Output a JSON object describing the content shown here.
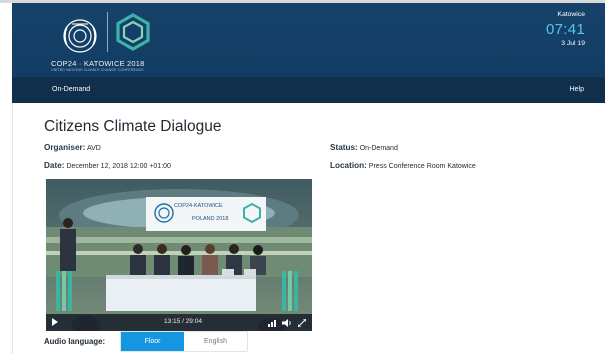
{
  "brand": {
    "event_title": "COP24 · KATOWICE 2018",
    "subtitle": "UNITED NATIONS CLIMATE CHANGE CONFERENCE"
  },
  "clock": {
    "location": "Katowice",
    "time": "07:41",
    "date": "3 Jul 19"
  },
  "nav": {
    "left": "On-Demand",
    "right": "Help"
  },
  "session": {
    "title": "Citizens Climate Dialogue",
    "organiser_label": "Organiser:",
    "organiser_value": "AVD",
    "status_label": "Status:",
    "status_value": "On-Demand",
    "date_label": "Date:",
    "date_value": "December 12, 2018 12:00 +01:00",
    "location_label": "Location:",
    "location_value": "Press Conference Room Katowice"
  },
  "video": {
    "backdrop_line1": "COP24·KATOWICE",
    "backdrop_line2": "POLAND 2018",
    "timecode": "13:15 / 29:04",
    "icons": [
      "play-icon",
      "quality-icon",
      "volume-icon",
      "fullscreen-icon"
    ]
  },
  "audio": {
    "label": "Audio language:",
    "options": [
      "Floor",
      "English"
    ],
    "selected": "Floor"
  },
  "colors": {
    "header_bg": "#16426a",
    "nav_bg": "#0f2f4d",
    "clock_time": "#58c5ef",
    "accent": "#1695e0"
  }
}
